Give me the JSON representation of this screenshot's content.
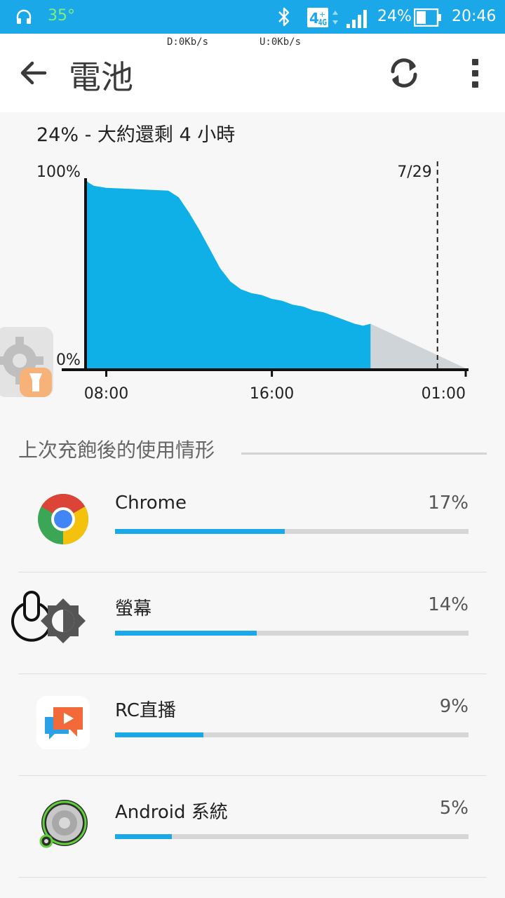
{
  "status_bar": {
    "temperature": "35°",
    "network_type": "4G",
    "battery_percent": "24%",
    "time": "20:46",
    "colors": {
      "background": "#1aa8e8",
      "temperature": "#7df07a"
    }
  },
  "net_speed": {
    "download": "D:0Kb/s",
    "upload": "U:0Kb/s"
  },
  "toolbar": {
    "title": "電池",
    "back_icon": "arrow-left-icon",
    "refresh_icon": "refresh-icon",
    "more_icon": "more-vert-icon"
  },
  "estimate": "24% - 大約還剩 4 小時",
  "chart_data": {
    "type": "area",
    "y_labels": [
      "100%",
      "0%"
    ],
    "x_tick_labels": [
      "08:00",
      "16:00",
      "01:00"
    ],
    "date_marker": "7/29",
    "ylim": [
      0,
      100
    ],
    "x_hours_range": [
      7,
      25.5
    ],
    "series": [
      {
        "kind": "actual",
        "color": "#0fb0e8",
        "x_hours": [
          7.0,
          7.1,
          7.4,
          8.0,
          9.0,
          10.0,
          11.0,
          11.5,
          12.0,
          12.5,
          13.0,
          13.5,
          14.0,
          14.5,
          15.0,
          15.5,
          16.0,
          16.5,
          17.0,
          17.5,
          18.0,
          18.5,
          19.0,
          19.5,
          20.0,
          20.4,
          20.77
        ],
        "values": [
          100,
          98,
          96,
          95,
          94.5,
          94,
          93.5,
          90,
          82,
          73,
          63,
          53,
          46,
          42,
          40,
          39,
          37,
          36,
          34,
          33,
          31,
          30,
          28,
          26,
          24,
          23,
          24
        ]
      },
      {
        "kind": "projected",
        "color": "#cfd4d8",
        "x_hours": [
          20.77,
          25.5
        ],
        "values": [
          24,
          0
        ]
      }
    ]
  },
  "section_title": "上次充飽後的使用情形",
  "usage": [
    {
      "name": "Chrome",
      "percent_label": "17%",
      "fill_fraction": 0.48,
      "icon": "chrome-icon"
    },
    {
      "name": "螢幕",
      "percent_label": "14%",
      "fill_fraction": 0.4,
      "icon": "screen-brightness-icon"
    },
    {
      "name": "RC直播",
      "percent_label": "9%",
      "fill_fraction": 0.25,
      "icon": "rc-live-icon"
    },
    {
      "name": "Android 系統",
      "percent_label": "5%",
      "fill_fraction": 0.16,
      "icon": "android-system-icon"
    }
  ]
}
